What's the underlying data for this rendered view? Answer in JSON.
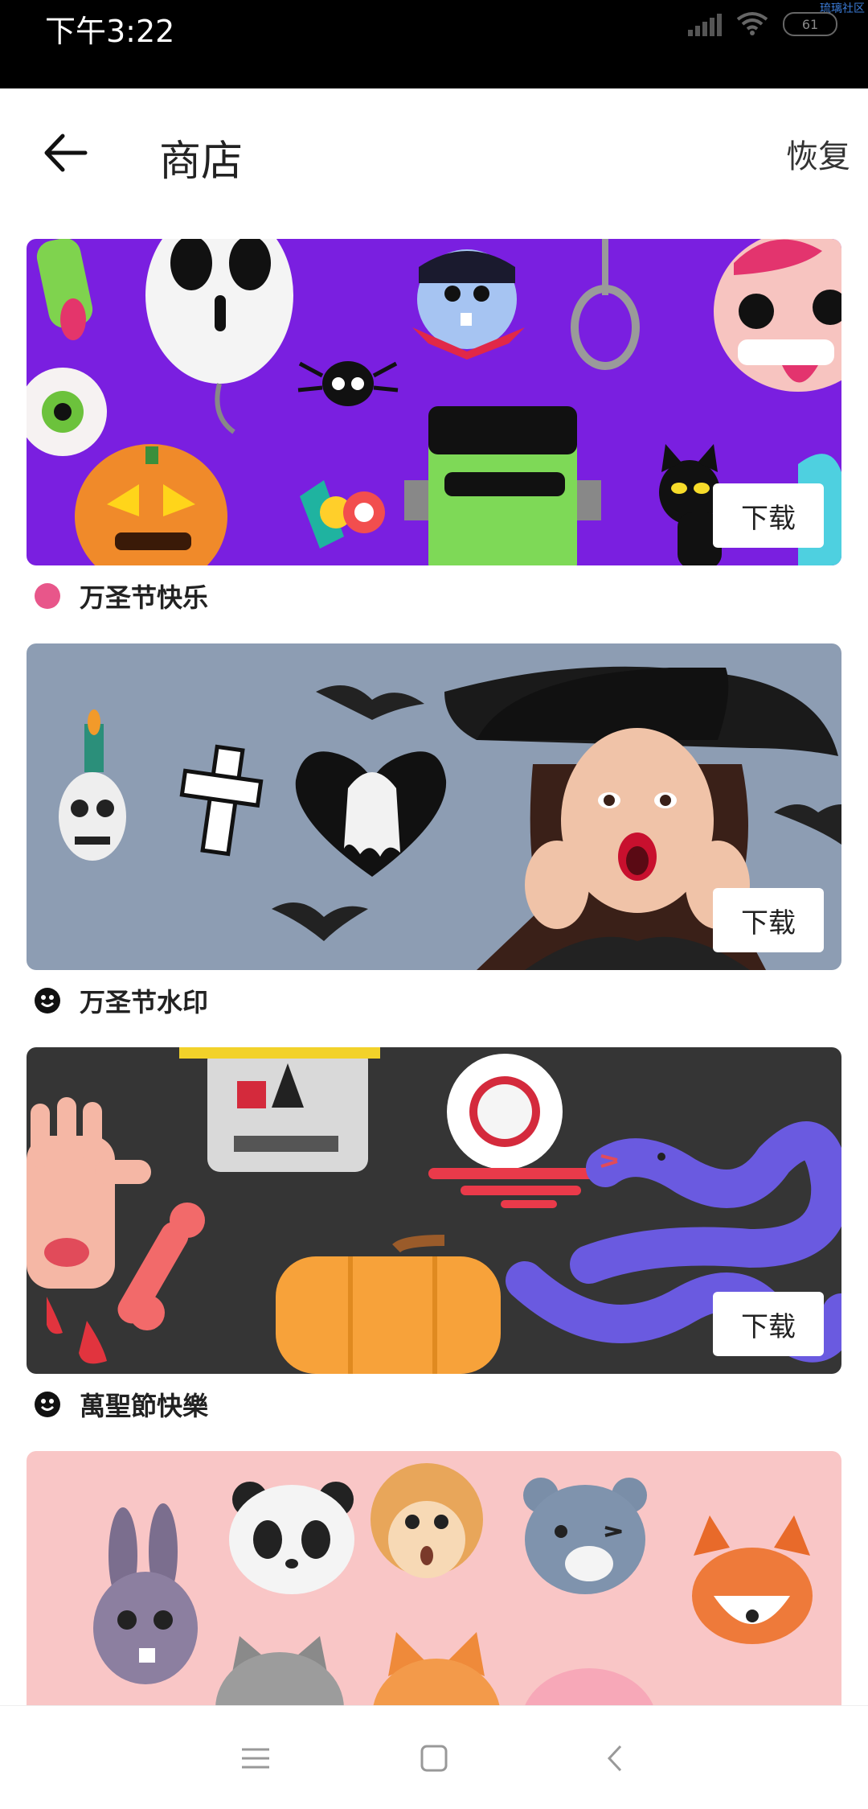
{
  "status_bar": {
    "time": "下午3:22",
    "battery": "61",
    "corner_text": "琉璃社区"
  },
  "app_bar": {
    "title": "商店",
    "restore_label": "恢复"
  },
  "cards": [
    {
      "name": "万圣节快乐",
      "download_label": "下载",
      "bg_color": "#7a1fe0",
      "icon_color": "#e8568a"
    },
    {
      "name": "万圣节水印",
      "download_label": "下载",
      "bg_color": "#8d9db3",
      "icon_color": "#111111"
    },
    {
      "name": "萬聖節快樂",
      "download_label": "下载",
      "bg_color": "#353535",
      "icon_color": "#111111"
    },
    {
      "name": "",
      "download_label": "",
      "bg_color": "#f9c6c6",
      "icon_color": "#111111"
    }
  ]
}
